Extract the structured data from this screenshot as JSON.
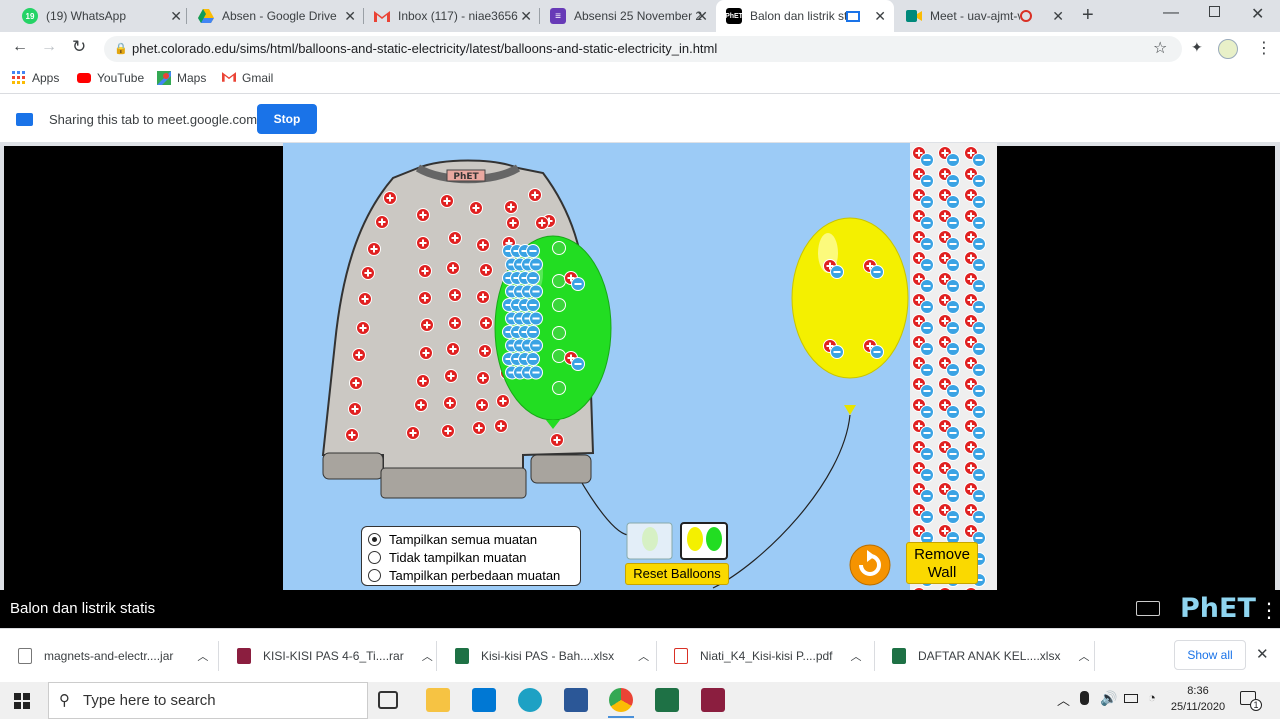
{
  "browser": {
    "tabs": [
      {
        "title": "(19) WhatsApp",
        "icon": "whatsapp-icon",
        "badge": "19",
        "color": "#25d366"
      },
      {
        "title": "Absen - Google Drive",
        "icon": "google-drive-icon",
        "color": "#fbbc04"
      },
      {
        "title": "Inbox (117) - niae3656",
        "icon": "gmail-icon",
        "color": "#ea4335"
      },
      {
        "title": "Absensi 25 November 2",
        "icon": "google-forms-icon",
        "color": "#673ab7"
      },
      {
        "title": "Balon dan listrik sta",
        "icon": "phet-icon",
        "color": "#000000",
        "active": true
      },
      {
        "title": "Meet - uav-ajmt-vk",
        "icon": "google-meet-icon",
        "color": "#00897b"
      }
    ],
    "url": "phet.colorado.edu/sims/html/balloons-and-static-electricity/latest/balloons-and-static-electricity_in.html",
    "bookmarks": [
      "Apps",
      "YouTube",
      "Maps",
      "Gmail"
    ]
  },
  "share_bar": {
    "text": "Sharing this tab to meet.google.com",
    "stop_label": "Stop"
  },
  "sim": {
    "title": "Balon dan listrik statis",
    "sweater_label": "PhET",
    "charge_options": [
      "Tampilkan semua muatan",
      "Tidak tampilkan muatan",
      "Tampilkan perbedaan muatan"
    ],
    "selected_option": "Tampilkan semua muatan",
    "reset_balloons_label": "Reset Balloons",
    "remove_wall_label": "Remove Wall",
    "logo_text": "PhET",
    "colors": {
      "background": "#9ccbf6",
      "green_balloon": "#22dd22",
      "yellow_balloon": "#f4f000",
      "button": "#fad900"
    }
  },
  "downloads": {
    "items": [
      {
        "name": "magnets-and-electr....jar",
        "icon": "file-icon"
      },
      {
        "name": "KISI-KISI PAS 4-6_Ti....rar",
        "icon": "winrar-icon"
      },
      {
        "name": "Kisi-kisi PAS - Bah....xlsx",
        "icon": "excel-icon"
      },
      {
        "name": "Niati_K4_Kisi-kisi P....pdf",
        "icon": "pdf-icon"
      },
      {
        "name": "DAFTAR ANAK KEL....xlsx",
        "icon": "excel-icon"
      }
    ],
    "show_all_label": "Show all"
  },
  "taskbar": {
    "search_placeholder": "Type here to search",
    "time": "8:36",
    "date": "25/11/2020",
    "notification_count": "1"
  }
}
